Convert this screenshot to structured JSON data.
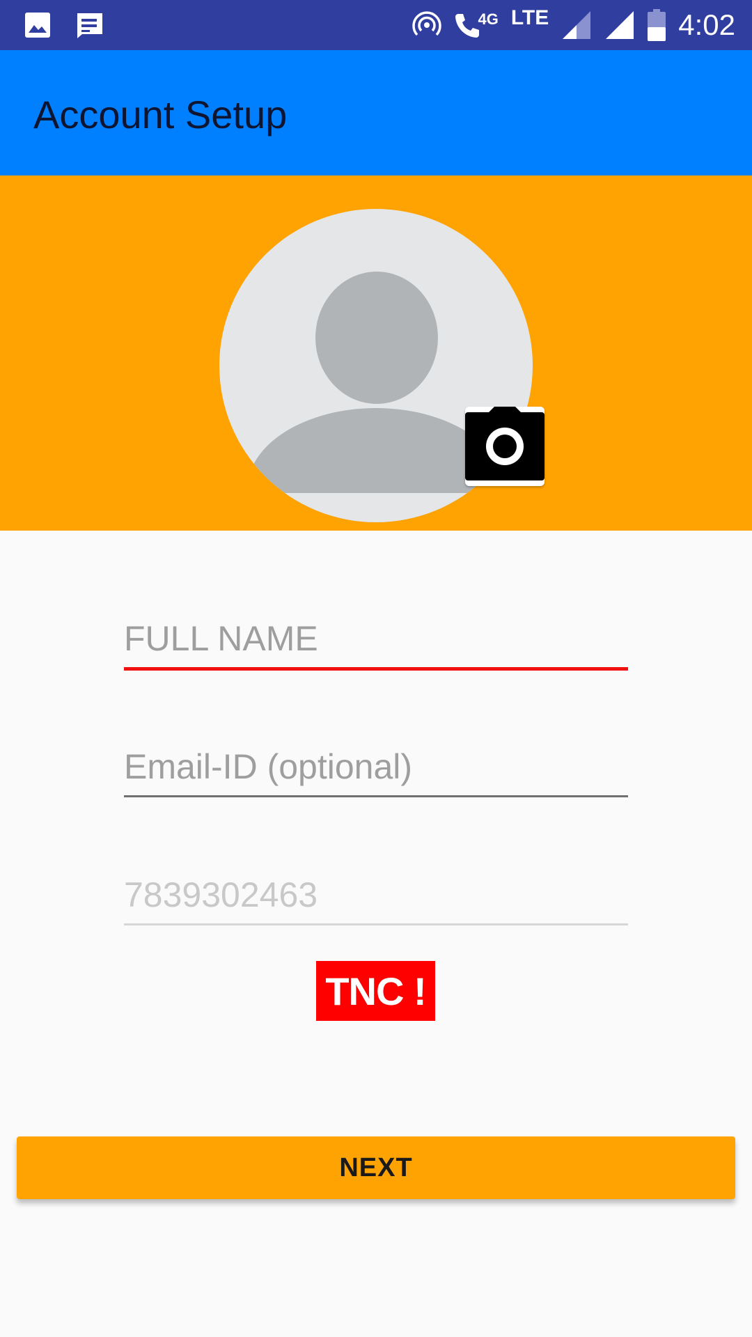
{
  "status_bar": {
    "left_icons": [
      "image-icon",
      "message-icon"
    ],
    "right_icons": [
      "hotspot-icon",
      "wifi-calling-icon",
      "signal-icon",
      "signal-full-icon",
      "battery-icon"
    ],
    "network_4g": "4G",
    "network_lte": "LTE",
    "time": "4:02"
  },
  "app_bar": {
    "title": "Account Setup"
  },
  "profile": {
    "avatar_icon": "person-placeholder-icon",
    "camera_icon": "camera-icon"
  },
  "form": {
    "full_name": {
      "value": "",
      "placeholder": "FULL NAME"
    },
    "email": {
      "value": "",
      "placeholder": "Email-ID (optional)"
    },
    "phone": {
      "value": "",
      "placeholder": "7839302463"
    },
    "tnc_label": "TNC !"
  },
  "actions": {
    "next_label": "NEXT"
  },
  "colors": {
    "status_bar": "#303f9f",
    "app_bar": "#007fff",
    "accent": "#ffa302",
    "error": "#f01010",
    "tnc": "#ff0000"
  }
}
